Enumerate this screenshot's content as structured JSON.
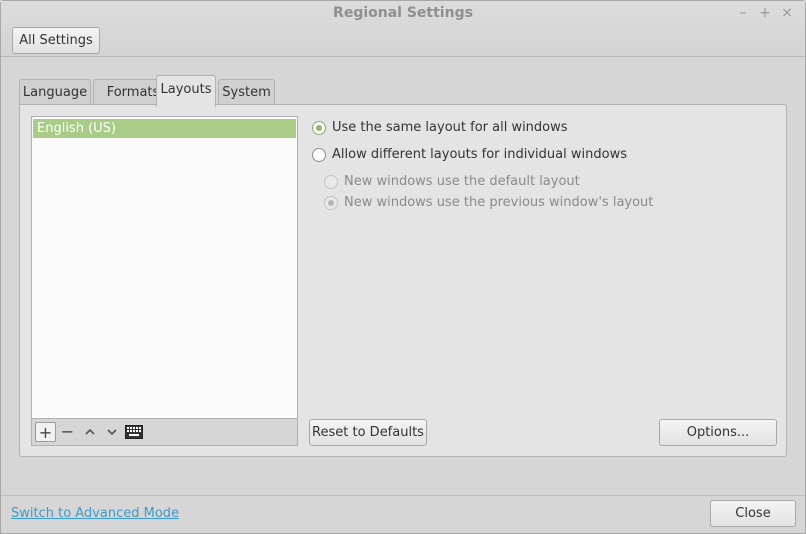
{
  "window": {
    "title": "Regional Settings",
    "controls": {
      "minimize": "–",
      "maximize": "+",
      "close": "×"
    }
  },
  "header": {
    "all_settings_label": "All Settings"
  },
  "tabs": [
    {
      "label": "Language",
      "active": false
    },
    {
      "label": "Formats",
      "active": false
    },
    {
      "label": "Layouts",
      "active": true
    },
    {
      "label": "System",
      "active": false
    }
  ],
  "layouts": {
    "items": [
      {
        "label": "English (US)",
        "selected": true
      }
    ],
    "toolbar": {
      "add": "+",
      "remove": "−",
      "up": "⌃",
      "down": "⌄",
      "keyboard_icon": "keyboard-icon"
    }
  },
  "options": {
    "same_layout": {
      "label": "Use the same layout for all windows",
      "checked": true
    },
    "different_layouts": {
      "label": "Allow different layouts for individual windows",
      "checked": false
    },
    "default_layout": {
      "label": "New windows use the default layout",
      "checked": false,
      "disabled": true
    },
    "previous_layout": {
      "label": "New windows use the previous window's layout",
      "checked": true,
      "disabled": true
    }
  },
  "buttons": {
    "reset": "Reset to Defaults",
    "options": "Options...",
    "close": "Close"
  },
  "footer": {
    "advanced_mode_link": "Switch to Advanced Mode"
  },
  "colors": {
    "selection": "#a8cc86",
    "radio_checked": "#8fb86b",
    "link": "#3d9ac7"
  }
}
